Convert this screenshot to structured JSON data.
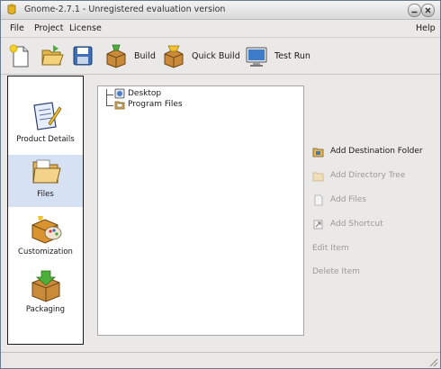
{
  "window": {
    "title": "Gnome-2.7.1 - Unregistered evaluation version"
  },
  "menu": {
    "file": "File",
    "project": "Project",
    "license": "License",
    "help": "Help"
  },
  "toolbar": {
    "build": "Build",
    "quick_build": "Quick Build",
    "test_run": "Test Run"
  },
  "categories": [
    {
      "label": "Product Details",
      "icon": "product-details-icon"
    },
    {
      "label": "Files",
      "icon": "files-folder-icon",
      "selected": true
    },
    {
      "label": "Customization",
      "icon": "customization-icon"
    },
    {
      "label": "Packaging",
      "icon": "packaging-icon"
    }
  ],
  "tree": [
    {
      "label": "Desktop",
      "icon": "desktop-folder-icon"
    },
    {
      "label": "Program Files",
      "icon": "program-files-folder-icon"
    }
  ],
  "actions": {
    "add_destination_folder": "Add Destination Folder",
    "add_directory_tree": "Add Directory Tree",
    "add_files": "Add Files",
    "add_shortcut": "Add Shortcut",
    "edit_item": "Edit Item",
    "delete_item": "Delete Item"
  },
  "colors": {
    "selected_category_bg": "#d6e2f3",
    "disabled_text": "#9a9a9a"
  }
}
